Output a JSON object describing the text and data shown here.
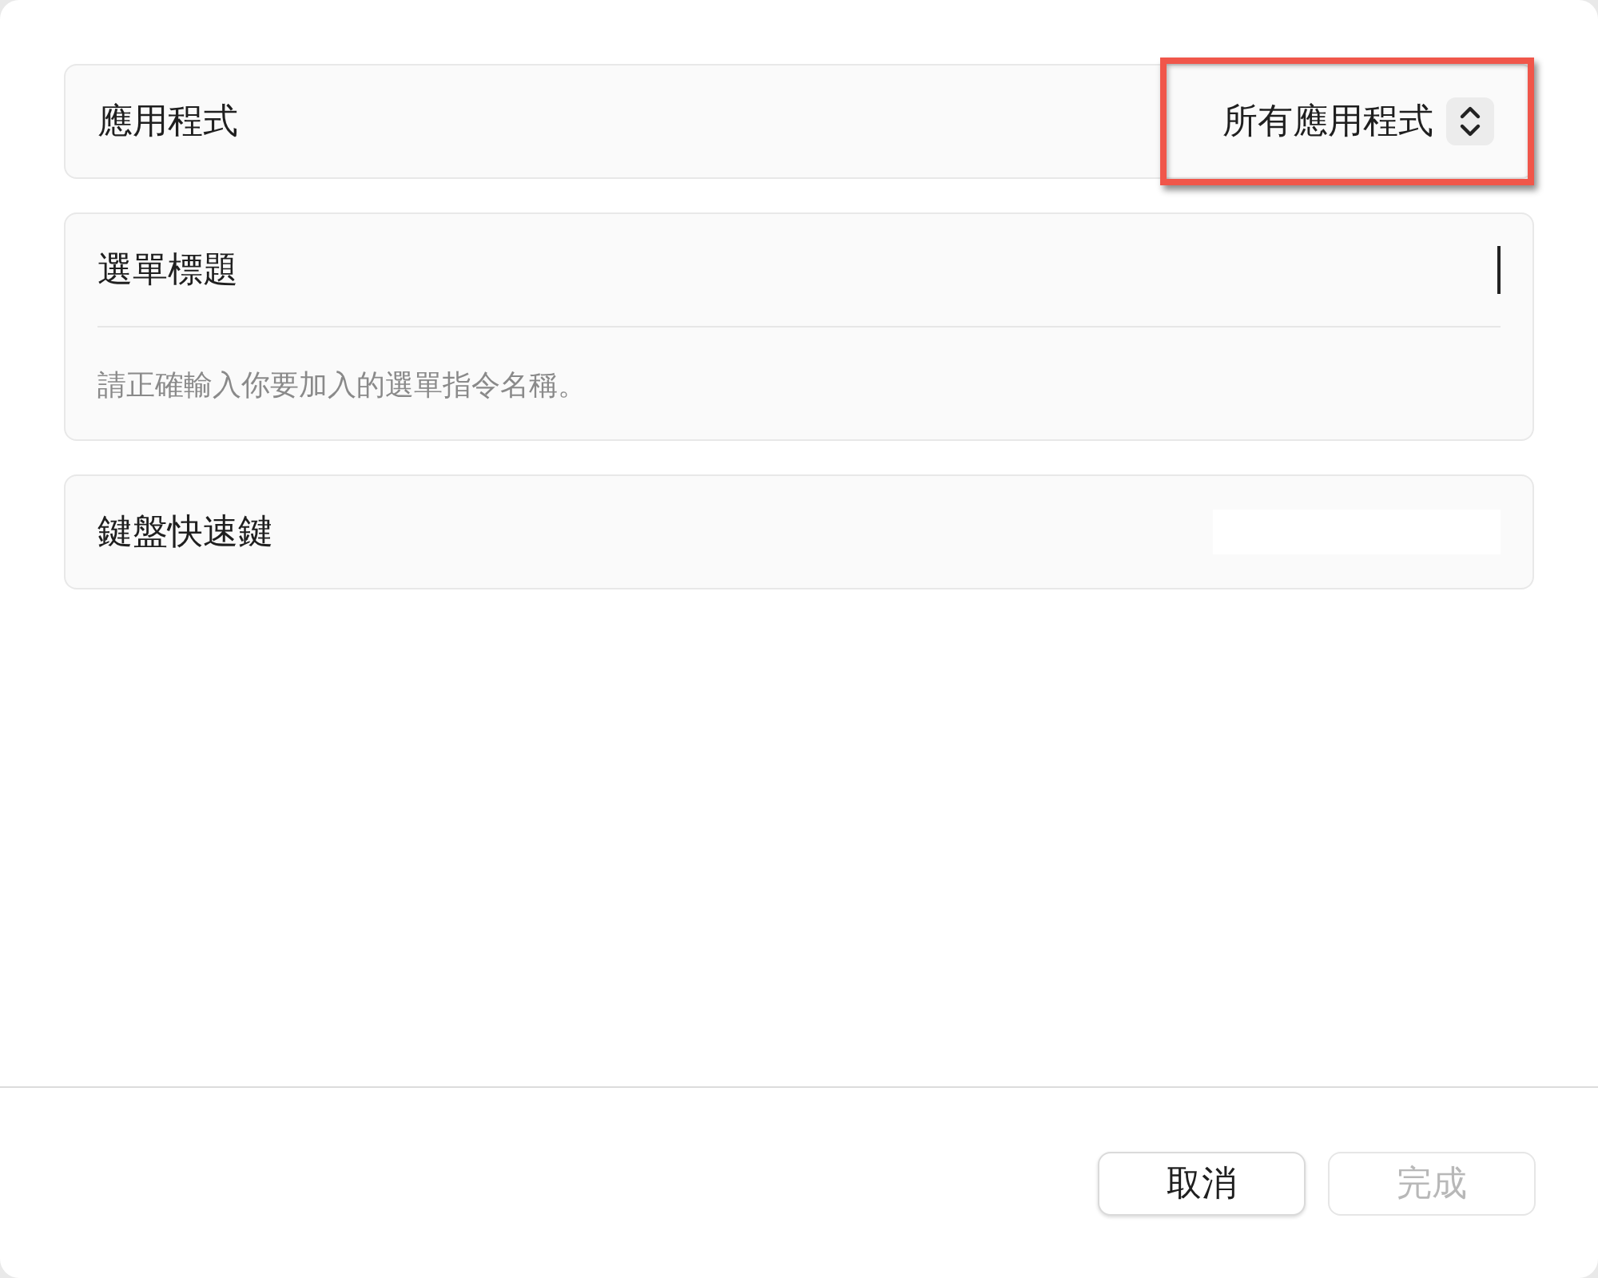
{
  "application_row": {
    "label": "應用程式",
    "popup": {
      "value": "所有應用程式",
      "highlighted": true
    }
  },
  "menu_title_row": {
    "label": "選單標題",
    "focused": true,
    "hint": "請正確輸入你要加入的選單指令名稱。"
  },
  "shortcut_row": {
    "label": "鍵盤快速鍵"
  },
  "buttons": [
    {
      "label": "取消",
      "disabled": false
    },
    {
      "label": "完成",
      "disabled": true
    }
  ]
}
